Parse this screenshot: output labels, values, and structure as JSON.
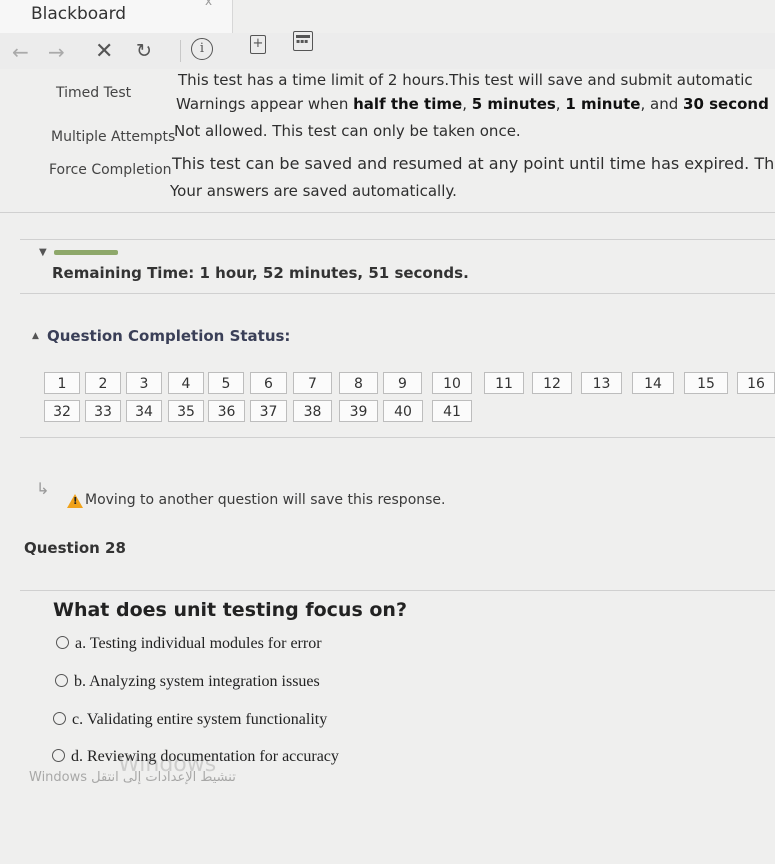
{
  "browser": {
    "app_title": "Blackboard",
    "tab_close": "x",
    "nav": {
      "back": "←",
      "forward": "→",
      "stop": "✕",
      "reload": "↻",
      "info": "i",
      "newtab": "+"
    }
  },
  "test_info": {
    "timed_label": "Timed Test",
    "timed_line1": "This test has a time limit of 2 hours.This test will save and submit automatic",
    "timed_line2_pre": "Warnings appear when ",
    "timed_line2_bold1": "half the time",
    "timed_line2_mid1": ", ",
    "timed_line2_bold2": "5 minutes",
    "timed_line2_mid2": ", ",
    "timed_line2_bold3": "1 minute",
    "timed_line2_mid3": ", and ",
    "timed_line2_bold4": "30 second",
    "attempts_label": "Multiple Attempts",
    "attempts_text": "Not allowed. This test can only be taken once.",
    "force_label": "Force Completion",
    "force_text": "This test can be saved and resumed at any point until time has expired. The t",
    "saved_text": "Your answers are saved automatically."
  },
  "progress": {
    "fraction": 0.1
  },
  "remaining": {
    "prefix": "Remaining Time: ",
    "hours": "1 hour",
    "sep1": ", ",
    "minutes": "52 minutes",
    "sep2": ", ",
    "seconds": "51 seconds."
  },
  "completion": {
    "label": "Question Completion Status:",
    "row1": [
      "1",
      "2",
      "3",
      "4",
      "5",
      "6",
      "7",
      "8",
      "9",
      "10",
      "11",
      "12",
      "13",
      "14",
      "15",
      "16"
    ],
    "row2": [
      "32",
      "33",
      "34",
      "35",
      "36",
      "37",
      "38",
      "39",
      "40",
      "41"
    ]
  },
  "notice": "Moving to another question will save this response.",
  "question": {
    "title": "Question 28",
    "text": "What does unit testing focus on?",
    "options": [
      "a. Testing individual modules for error",
      "b. Analyzing system integration issues",
      "c. Validating entire system functionality",
      "d. Reviewing documentation for accuracy"
    ]
  },
  "watermark": {
    "line1": "Windows",
    "line2": "Windows تنشيط الإعدادات إلى انتقل"
  }
}
